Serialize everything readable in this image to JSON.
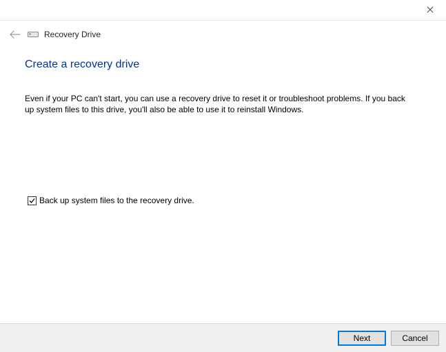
{
  "window": {
    "title": "Recovery Drive"
  },
  "page": {
    "heading": "Create a recovery drive",
    "body": "Even if your PC can't start, you can use a recovery drive to reset it or troubleshoot problems. If you back up system files to this drive, you'll also be able to use it to reinstall Windows."
  },
  "checkbox": {
    "checked": true,
    "label": "Back up system files to the recovery drive."
  },
  "footer": {
    "next": "Next",
    "cancel": "Cancel"
  }
}
